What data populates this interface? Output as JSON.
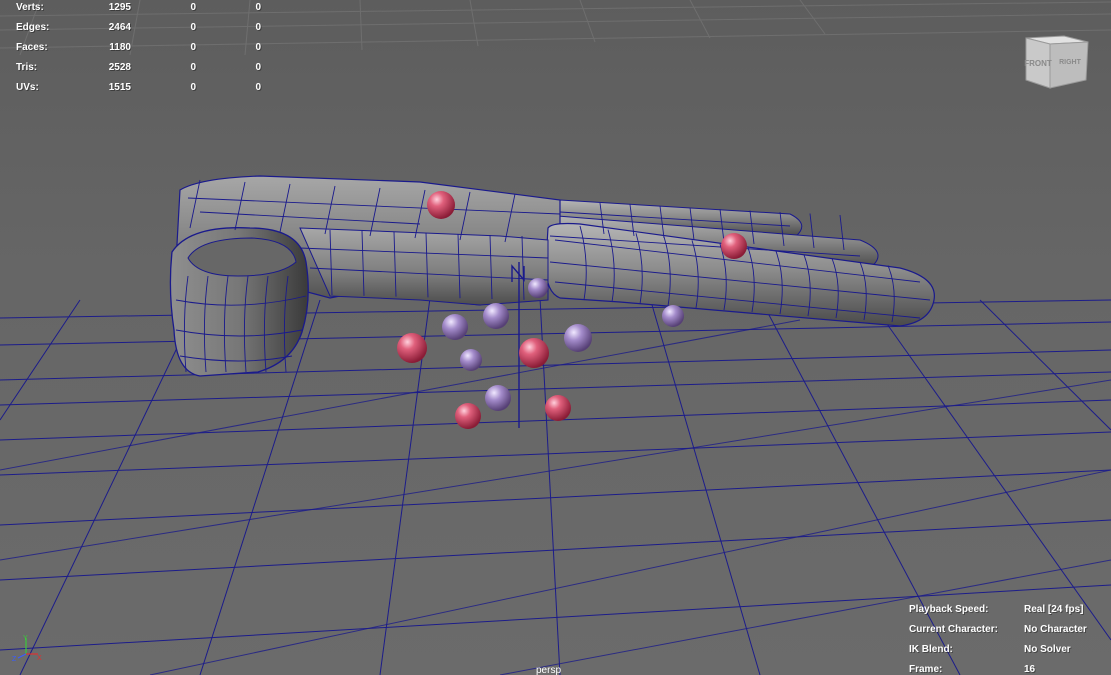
{
  "poly_stats": [
    {
      "label": "Verts:",
      "values": [
        "1295",
        "0",
        "0"
      ]
    },
    {
      "label": "Edges:",
      "values": [
        "2464",
        "0",
        "0"
      ]
    },
    {
      "label": "Faces:",
      "values": [
        "1180",
        "0",
        "0"
      ]
    },
    {
      "label": "Tris:",
      "values": [
        "2528",
        "0",
        "0"
      ]
    },
    {
      "label": "UVs:",
      "values": [
        "1515",
        "0",
        "0"
      ]
    }
  ],
  "viewcube": {
    "front": "FRONT",
    "right": "RIGHT"
  },
  "hud": [
    {
      "label": "Playback Speed:",
      "value": "Real [24 fps]"
    },
    {
      "label": "Current Character:",
      "value": "No Character"
    },
    {
      "label": "IK Blend:",
      "value": "No Solver"
    },
    {
      "label": "Frame:",
      "value": "16"
    }
  ],
  "camera": "persp",
  "axis_labels": {
    "x": "X",
    "y": "Y",
    "z": "Z"
  },
  "colors": {
    "wire": "#1a1a8c",
    "mesh": "#8a8a8a",
    "pink_sphere": "#d44a6a",
    "lavender_sphere": "#a58cc8"
  }
}
